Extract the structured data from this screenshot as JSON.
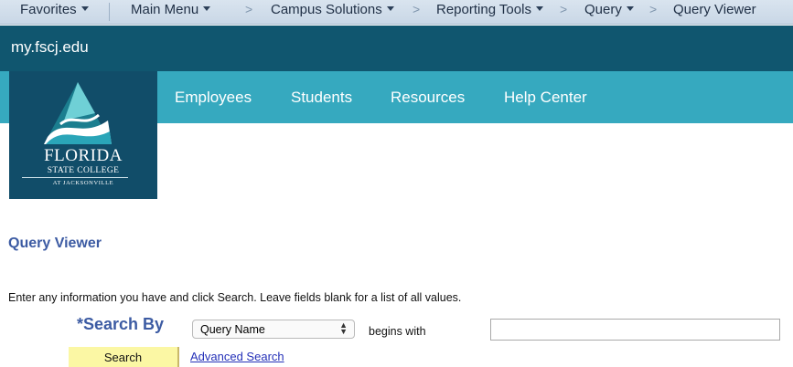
{
  "topbar": {
    "favorites": "Favorites",
    "main_menu": "Main Menu",
    "crumbs": [
      "Campus Solutions",
      "Reporting Tools",
      "Query",
      "Query Viewer"
    ],
    "separator": ">"
  },
  "site": {
    "title": "my.fscj.edu"
  },
  "menu": {
    "items": [
      "Employees",
      "Students",
      "Resources",
      "Help Center"
    ]
  },
  "logo": {
    "line1": "FLORIDA",
    "line2": "STATE COLLEGE",
    "line3": "AT JACKSONVILLE"
  },
  "page": {
    "title": "Query Viewer",
    "instructions": "Enter any information you have and click Search. Leave fields blank for a list of all values."
  },
  "search": {
    "search_by_label": "*Search By",
    "field_selected": "Query Name",
    "operator": "begins with",
    "value": "",
    "search_button": "Search",
    "advanced_link": "Advanced Search"
  },
  "colors": {
    "site_band": "#10566f",
    "menu_band": "#36a9bf",
    "title_blue": "#3c5ba3",
    "search_button_bg": "#fbf7a4",
    "link_blue": "#2430b8"
  }
}
